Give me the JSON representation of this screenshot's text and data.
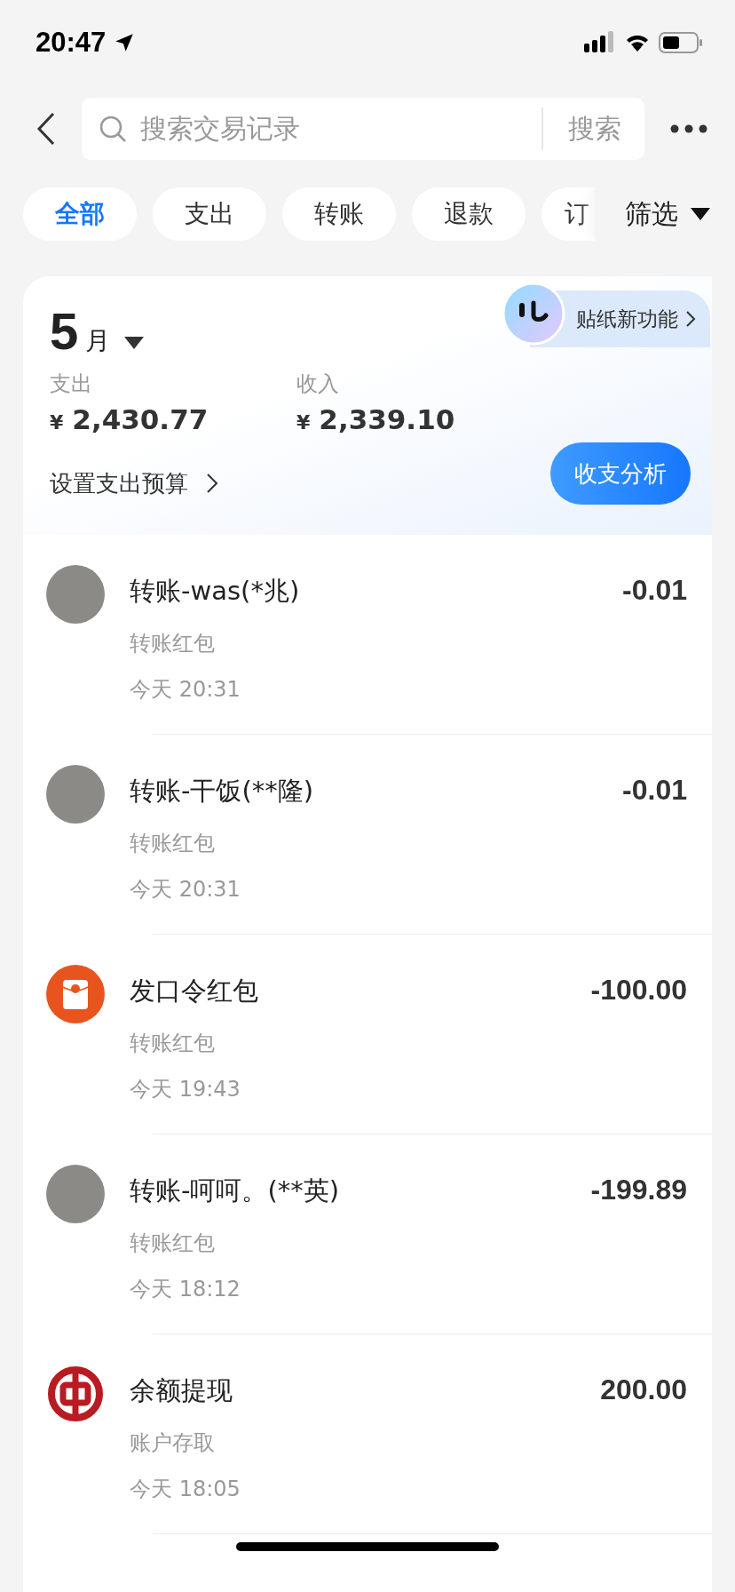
{
  "status_bar": {
    "time": "20:47"
  },
  "search": {
    "placeholder": "搜索交易记录",
    "button": "搜索"
  },
  "tabs": [
    {
      "label": "全部",
      "selected": true
    },
    {
      "label": "支出",
      "selected": false
    },
    {
      "label": "转账",
      "selected": false
    },
    {
      "label": "退款",
      "selected": false
    },
    {
      "label": "订",
      "selected": false
    }
  ],
  "filter": "筛选",
  "summary": {
    "month": "5",
    "month_unit": "月",
    "sticker_link": "贴纸新功能",
    "expense_label": "支出",
    "expense": "2,430.77",
    "income_label": "收入",
    "income": "2,339.10",
    "currency": "¥",
    "budget_link": "设置支出预算",
    "analysis_button": "收支分析"
  },
  "transactions": [
    {
      "kind": "photo",
      "title": "转账-was(*兆)",
      "category": "转账红包",
      "time": "今天 20:31",
      "amount": "-0.01"
    },
    {
      "kind": "photo",
      "title": "转账-干饭(**隆)",
      "category": "转账红包",
      "time": "今天 20:31",
      "amount": "-0.01"
    },
    {
      "kind": "red-packet",
      "title": "发口令红包",
      "category": "转账红包",
      "time": "今天 19:43",
      "amount": "-100.00"
    },
    {
      "kind": "photo",
      "title": "转账-呵呵。(**英)",
      "category": "转账红包",
      "time": "今天 18:12",
      "amount": "-199.89"
    },
    {
      "kind": "bank",
      "title": "余额提现",
      "category": "账户存取",
      "time": "今天 18:05",
      "amount": "200.00"
    }
  ]
}
